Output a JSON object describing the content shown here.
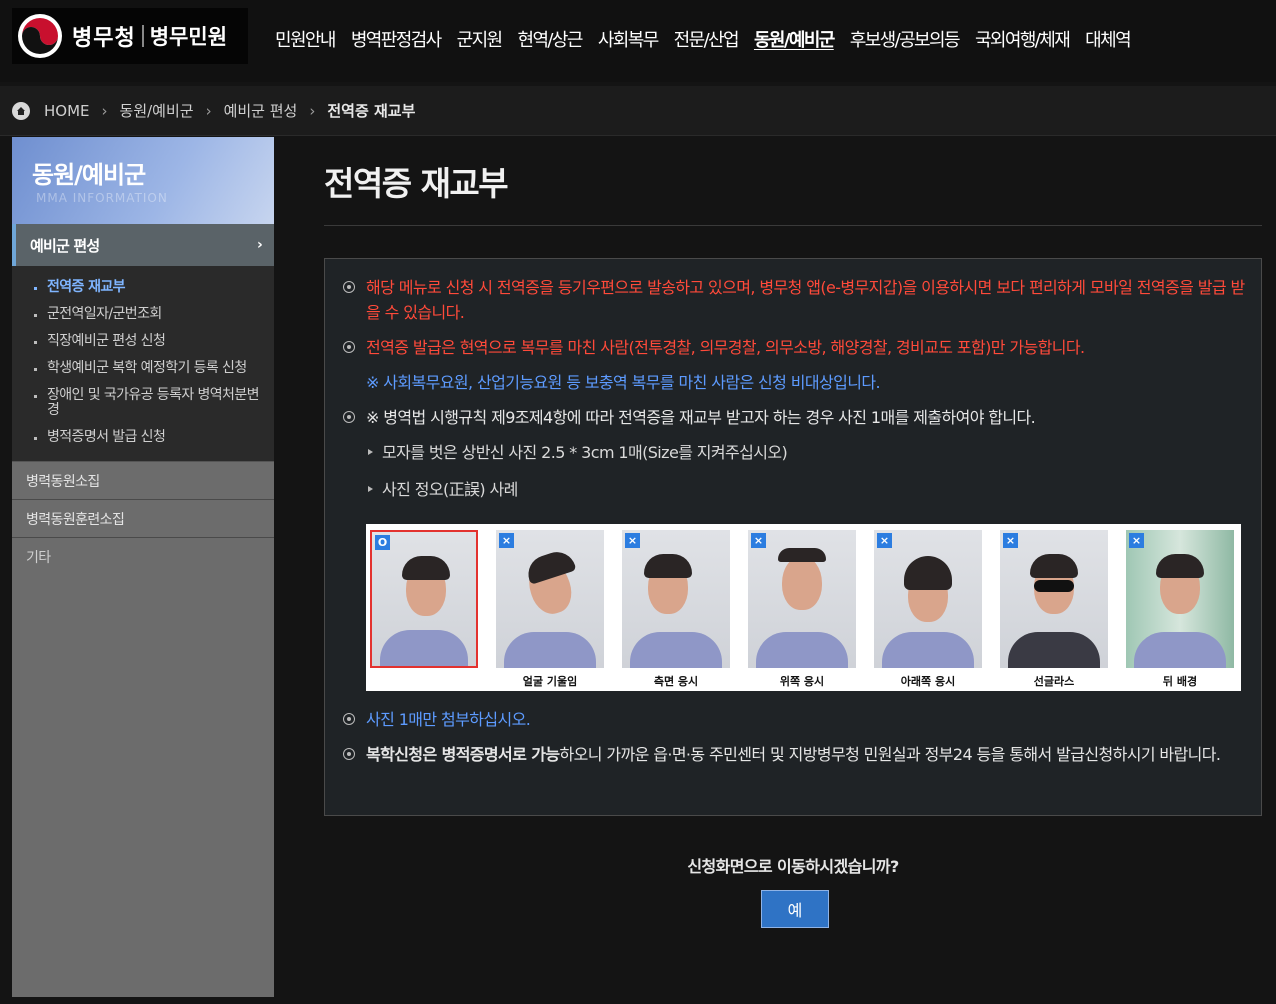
{
  "header": {
    "brand": "병무청",
    "brand_sub": "병무민원",
    "nav": [
      "민원안내",
      "병역판정검사",
      "군지원",
      "현역/상근",
      "사회복무",
      "전문/산업",
      "동원/예비군",
      "후보생/공보의등",
      "국외여행/체재",
      "대체역"
    ],
    "active_nav": "동원/예비군"
  },
  "breadcrumb": {
    "home": "HOME",
    "items": [
      "동원/예비군",
      "예비군 편성"
    ],
    "current": "전역증 재교부"
  },
  "sidebar": {
    "title": "동원/예비군",
    "subtitle": "MMA INFORMATION",
    "section": "예비군 편성",
    "section_icon": "chevron-right-icon",
    "links": [
      "전역증 재교부",
      "군전역일자/군번조회",
      "직장예비군 편성 신청",
      "학생예비군 복학 예정학기 등록 신청",
      "장애인 및 국가유공 등록자 병역처분변경",
      "병적증명서 발급 신청"
    ],
    "current_link": "전역증 재교부",
    "sections": [
      "병력동원소집",
      "병력동원훈련소집",
      "기타"
    ]
  },
  "main": {
    "title": "전역증 재교부",
    "notice1": "해당 메뉴로 신청 시 전역증을 등기우편으로 발송하고 있으며, 병무청 앱(e-병무지갑)을 이용하시면 보다 편리하게 모바일 전역증을 발급 받을 수 있습니다.",
    "notice2": "전역증 발급은 현역으로 복무를 마친 사람(전투경찰, 의무경찰, 의무소방, 해양경찰, 경비교도 포함)만 가능합니다.",
    "notice2_sub": "※ 사회복무요원, 산업기능요원 등 보충역 복무를 마친 사람은 신청 비대상입니다.",
    "notice3": "※ 병역법 시행규칙 제9조제4항에 따라 전역증을 재교부 받고자 하는 경우 사진 1매를 제출하여야 합니다.",
    "notice3_sub1": "모자를 벗은 상반신 사진 2.5 * 3cm 1매(Size를 지켜주십시오)",
    "notice3_sub2": "사진 정오(正誤) 사례",
    "photos": [
      {
        "badge": "O",
        "caption": ""
      },
      {
        "badge": "×",
        "caption": "얼굴 기울임"
      },
      {
        "badge": "×",
        "caption": "측면 응시"
      },
      {
        "badge": "×",
        "caption": "위쪽 응시"
      },
      {
        "badge": "×",
        "caption": "아래쪽 응시"
      },
      {
        "badge": "×",
        "caption": "선글라스"
      },
      {
        "badge": "×",
        "caption": "뒤 배경"
      }
    ],
    "notice4": "사진 1매만 첨부하십시오.",
    "notice5_bold": "복학신청은 병적증명서로 가능",
    "notice5_rest": "하오니 가까운 읍·면·동 주민센터 및 지방병무청 민원실과 정부24 등을 통해서 발급신청하시기 바랍니다.",
    "prompt": "신청화면으로 이동하시겠습니까?",
    "yes_button": "예"
  },
  "colors": {
    "background": "#141414",
    "red_text": "#ff4a3a",
    "blue_text": "#5d9bff",
    "button": "#2f73c5",
    "sidebar": "#6c6c6c"
  }
}
